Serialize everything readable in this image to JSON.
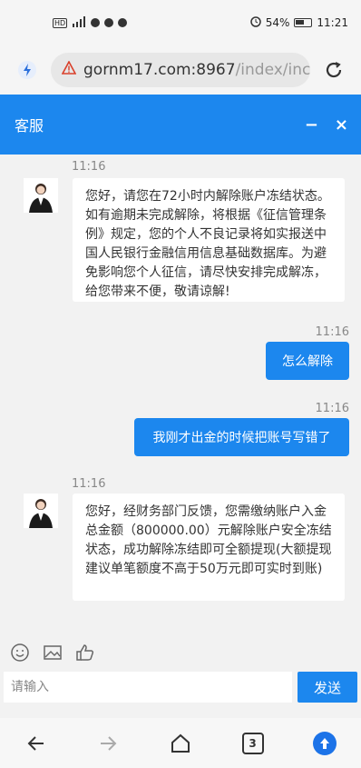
{
  "status_bar": {
    "battery": "54%",
    "time": "11:21"
  },
  "browser": {
    "url_main": "gornm17.com:8967",
    "url_path": "/index/inc",
    "tab_count": "3"
  },
  "header": {
    "title": "客服",
    "minimize_label": "−",
    "close_label": "×"
  },
  "messages": [
    {
      "time": "11:16",
      "text": "您好，请您在72小时内解除账户冻结状态。如有逾期未完成解除，将根据《征信管理条例》规定，您的个人不良记录将如实报送中国人民银行金融信用信息基础数据库。为避免影响您个人征信，请尽快安排完成解冻，给您带来不便，敬请谅解!"
    },
    {
      "time": "11:16",
      "text": "怎么解除"
    },
    {
      "time": "11:16",
      "text": "我刚才出金的时候把账号写错了"
    },
    {
      "time": "11:16",
      "text": "您好，经财务部门反馈，您需缴纳账户入金总金额（800000.00）元解除账户安全冻结状态，成功解除冻结即可全额提现(大额提现建议单笔额度不高于50万元即可实时到账)"
    }
  ],
  "composer": {
    "placeholder": "请输入",
    "send_label": "发送"
  },
  "colors": {
    "accent": "#1c87ee",
    "background": "#f2f2f2"
  }
}
